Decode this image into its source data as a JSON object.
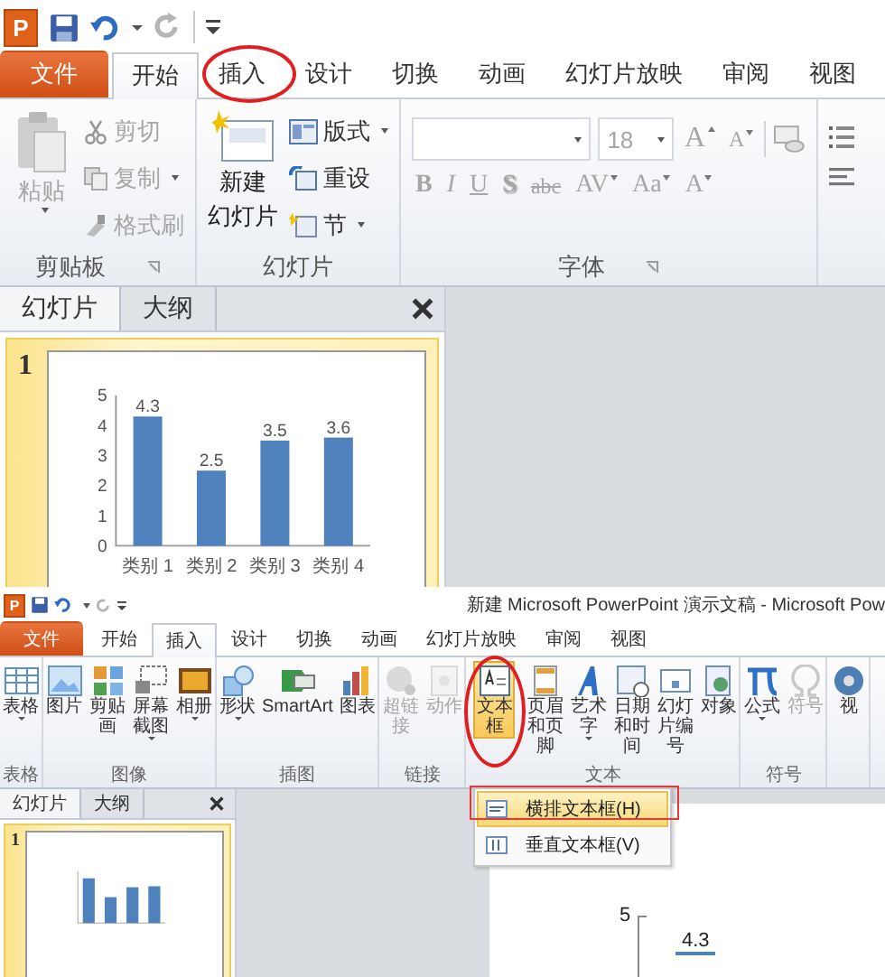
{
  "top": {
    "quick_access": {
      "app_letter": "P"
    },
    "tabs": [
      {
        "label": "文件",
        "kind": "file",
        "selected": false
      },
      {
        "label": "开始",
        "kind": "tab",
        "selected": true
      },
      {
        "label": "插入",
        "kind": "tab",
        "selected": false
      },
      {
        "label": "设计",
        "kind": "tab",
        "selected": false
      },
      {
        "label": "切换",
        "kind": "tab",
        "selected": false
      },
      {
        "label": "动画",
        "kind": "tab",
        "selected": false
      },
      {
        "label": "幻灯片放映",
        "kind": "tab",
        "selected": false
      },
      {
        "label": "审阅",
        "kind": "tab",
        "selected": false
      },
      {
        "label": "视图",
        "kind": "tab",
        "selected": false
      }
    ],
    "clipboard": {
      "label": "剪贴板",
      "paste": {
        "label": "粘贴",
        "disabled": true
      },
      "items": [
        {
          "kind": "cut",
          "label": "剪切",
          "disabled": true,
          "menu": false
        },
        {
          "kind": "copy",
          "label": "复制",
          "disabled": true,
          "menu": true
        },
        {
          "kind": "painter",
          "label": "格式刷",
          "disabled": true,
          "menu": false
        }
      ]
    },
    "slides": {
      "label": "幻灯片",
      "new_slide": {
        "lines": [
          "新建",
          "幻灯片"
        ]
      },
      "items": [
        {
          "kind": "layout",
          "label": "版式",
          "menu": true
        },
        {
          "kind": "reset",
          "label": "重设",
          "menu": false
        },
        {
          "kind": "section",
          "label": "节",
          "menu": true
        }
      ]
    },
    "font": {
      "label": "字体",
      "disabled": true,
      "font_size": "18",
      "size_buttons": [
        {
          "kind": "grow",
          "label": "A"
        },
        {
          "kind": "shrink",
          "label": "A"
        }
      ],
      "format_buttons": [
        {
          "kind": "bold",
          "label": "B"
        },
        {
          "kind": "italic",
          "label": "I"
        },
        {
          "kind": "underline",
          "label": "U"
        },
        {
          "kind": "shadow",
          "label": "S"
        },
        {
          "kind": "strike",
          "label": "abc"
        },
        {
          "kind": "spacing",
          "label": "AV"
        },
        {
          "kind": "case",
          "label": "Aa"
        },
        {
          "kind": "color",
          "label": "A"
        }
      ]
    },
    "slide_panel": {
      "tabs": [
        {
          "label": "幻灯片",
          "selected": true
        },
        {
          "label": "大纲",
          "selected": false
        }
      ],
      "slides": [
        {
          "number": "1",
          "selected": true,
          "chart_data": {
            "type": "bar",
            "categories": [
              "类别 1",
              "类别 2",
              "类别 3",
              "类别 4"
            ],
            "values": [
              4.3,
              2.5,
              3.5,
              3.6
            ],
            "ylim": [
              0,
              5
            ],
            "yticks": [
              0,
              1,
              2,
              3,
              4,
              5
            ],
            "data_labels": true
          }
        }
      ]
    }
  },
  "bottom": {
    "quick_access": {
      "app_letter": "P"
    },
    "title": "新建 Microsoft PowerPoint 演示文稿 - Microsoft Pow",
    "tabs": [
      {
        "label": "文件",
        "kind": "file",
        "selected": false
      },
      {
        "label": "开始",
        "kind": "tab",
        "selected": false
      },
      {
        "label": "插入",
        "kind": "tab",
        "selected": true
      },
      {
        "label": "设计",
        "kind": "tab",
        "selected": false
      },
      {
        "label": "切换",
        "kind": "tab",
        "selected": false
      },
      {
        "label": "动画",
        "kind": "tab",
        "selected": false
      },
      {
        "label": "幻灯片放映",
        "kind": "tab",
        "selected": false
      },
      {
        "label": "审阅",
        "kind": "tab",
        "selected": false
      },
      {
        "label": "视图",
        "kind": "tab",
        "selected": false
      }
    ],
    "groups": [
      {
        "label": "表格",
        "buttons": [
          {
            "kind": "table",
            "label": "表格",
            "menu": true,
            "disabled": false,
            "pressed": false
          }
        ]
      },
      {
        "label": "图像",
        "buttons": [
          {
            "kind": "picture",
            "label": "图片",
            "menu": false,
            "disabled": false,
            "pressed": false
          },
          {
            "kind": "clipart",
            "label": "剪贴画",
            "menu": false,
            "disabled": false,
            "pressed": false
          },
          {
            "kind": "screenshot",
            "label": "屏幕截图",
            "menu": true,
            "disabled": false,
            "pressed": false
          },
          {
            "kind": "album",
            "label": "相册",
            "menu": true,
            "disabled": false,
            "pressed": false
          }
        ]
      },
      {
        "label": "插图",
        "buttons": [
          {
            "kind": "shapes",
            "label": "形状",
            "menu": true,
            "disabled": false,
            "pressed": false
          },
          {
            "kind": "smartart",
            "label": "SmartArt",
            "menu": false,
            "disabled": false,
            "pressed": false
          },
          {
            "kind": "chart",
            "label": "图表",
            "menu": false,
            "disabled": false,
            "pressed": false
          }
        ]
      },
      {
        "label": "链接",
        "buttons": [
          {
            "kind": "hyperlink",
            "label": "超链接",
            "menu": false,
            "disabled": true,
            "pressed": false
          },
          {
            "kind": "action",
            "label": "动作",
            "menu": false,
            "disabled": true,
            "pressed": false
          }
        ]
      },
      {
        "label": "文本",
        "buttons": [
          {
            "kind": "textbox",
            "label": "文本框",
            "menu": false,
            "disabled": false,
            "pressed": true
          },
          {
            "kind": "header",
            "label": "页眉和页脚",
            "menu": false,
            "disabled": false,
            "pressed": false
          },
          {
            "kind": "wordart",
            "label": "艺术字",
            "menu": true,
            "disabled": false,
            "pressed": false
          },
          {
            "kind": "datetime",
            "label": "日期和时间",
            "menu": false,
            "disabled": false,
            "pressed": false
          },
          {
            "kind": "slidenumber",
            "label": "幻灯片编号",
            "menu": false,
            "disabled": false,
            "pressed": false
          },
          {
            "kind": "object",
            "label": "对象",
            "menu": false,
            "disabled": false,
            "pressed": false
          }
        ]
      },
      {
        "label": "符号",
        "buttons": [
          {
            "kind": "equation",
            "label": "公式",
            "menu": true,
            "disabled": false,
            "pressed": false
          },
          {
            "kind": "symbol",
            "label": "符号",
            "menu": false,
            "disabled": true,
            "pressed": false
          }
        ]
      },
      {
        "buttons": [
          {
            "kind": "video",
            "label": "视",
            "menu": false,
            "disabled": false,
            "pressed": false
          }
        ]
      }
    ],
    "text_box_menu": [
      {
        "kind": "horizontal",
        "label": "横排文本框(H)",
        "selected": true
      },
      {
        "kind": "vertical",
        "label": "垂直文本框(V)",
        "selected": false
      }
    ],
    "slide_panel": {
      "tabs": [
        {
          "label": "幻灯片",
          "selected": true
        },
        {
          "label": "大纲",
          "selected": false
        }
      ],
      "slides": [
        {
          "number": "1",
          "selected": true
        }
      ]
    },
    "slide": {
      "axis_tick": "5",
      "data_label": "4.3"
    }
  }
}
